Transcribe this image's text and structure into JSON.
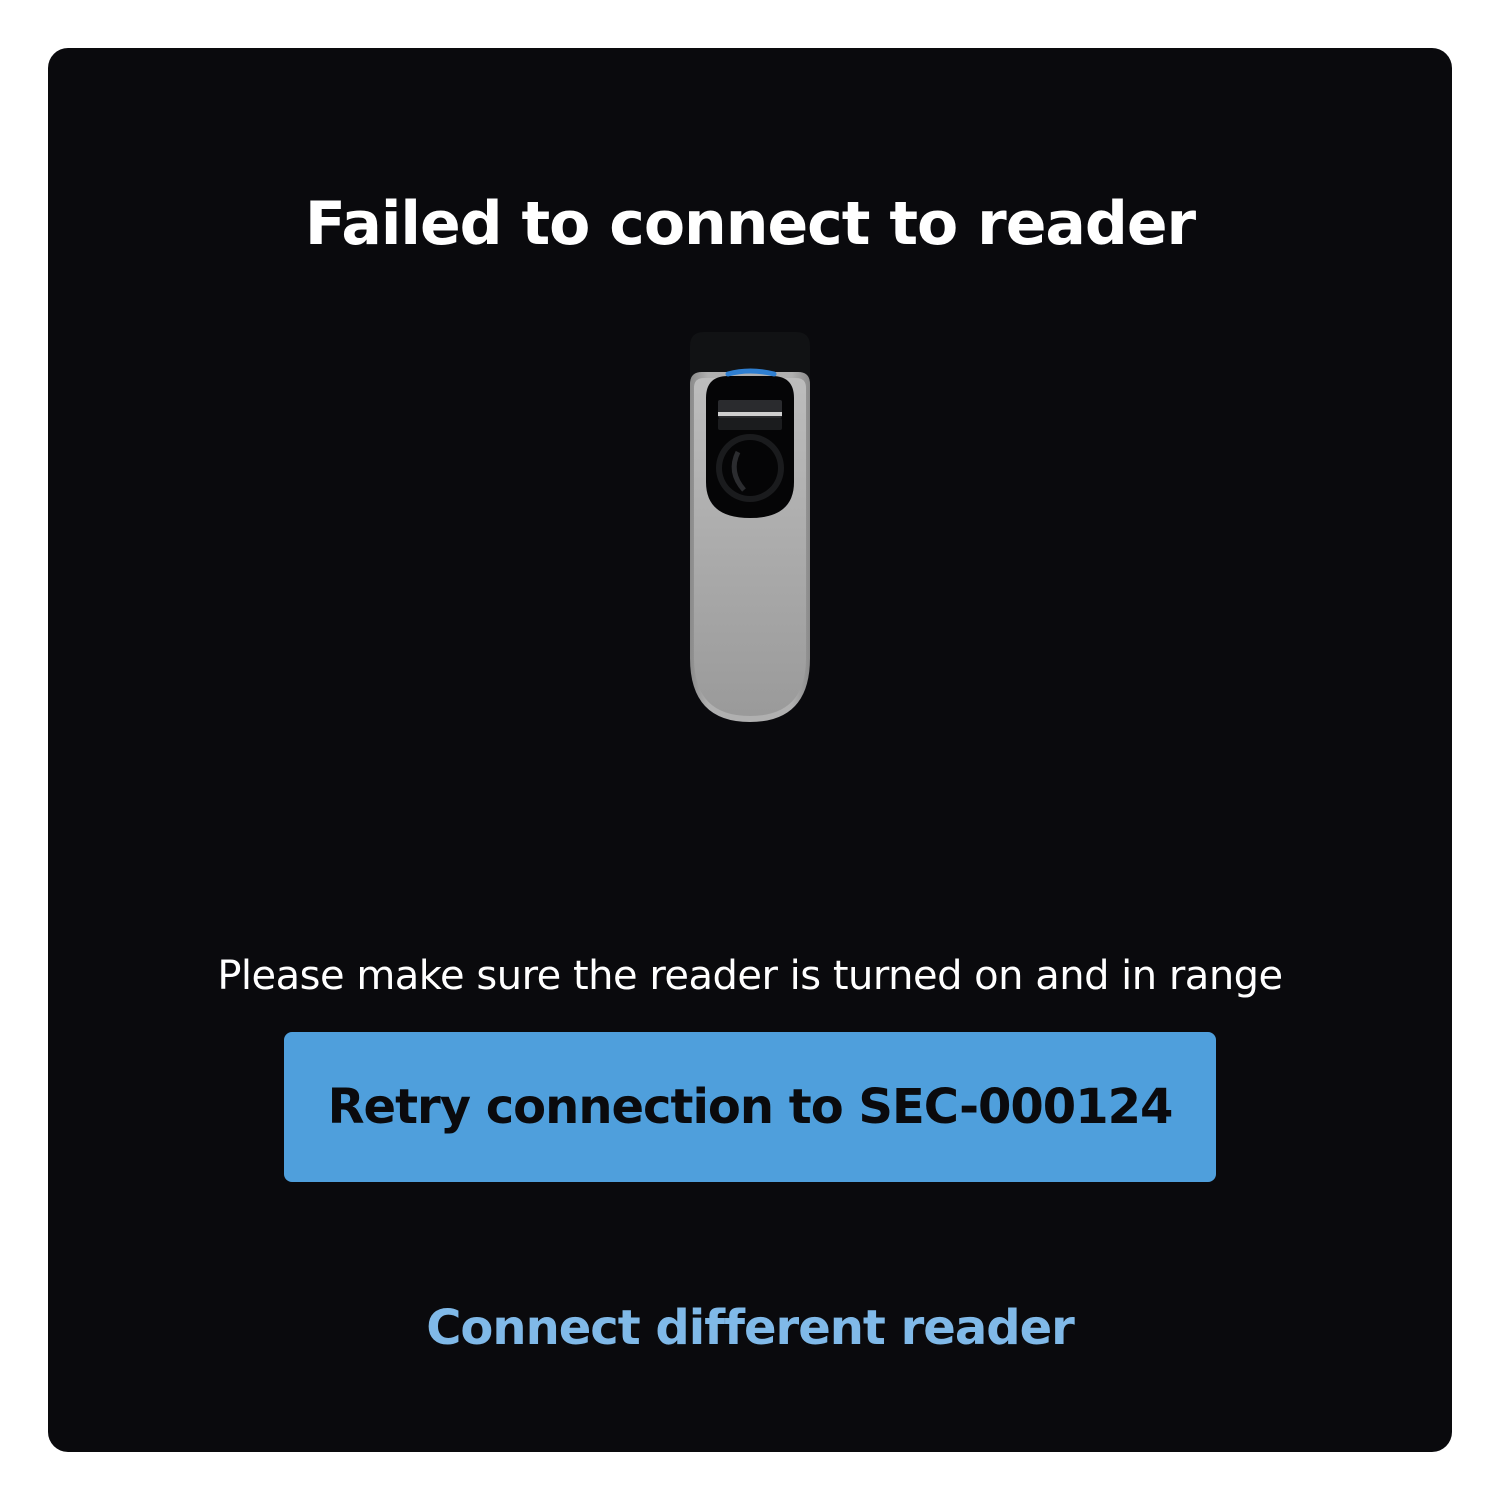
{
  "dialog": {
    "title": "Failed to connect to reader",
    "message": "Please make sure the reader is turned on and in range",
    "retry_button_label": "Retry connection to SEC-000124",
    "secondary_link_label": "Connect different reader"
  },
  "illustration": {
    "icon": "card-reader-icon",
    "indicator_color": "#2f7fd1"
  },
  "colors": {
    "card_background": "#0a0a0d",
    "primary_button": "#4f9fdc",
    "link": "#80b9e8"
  }
}
